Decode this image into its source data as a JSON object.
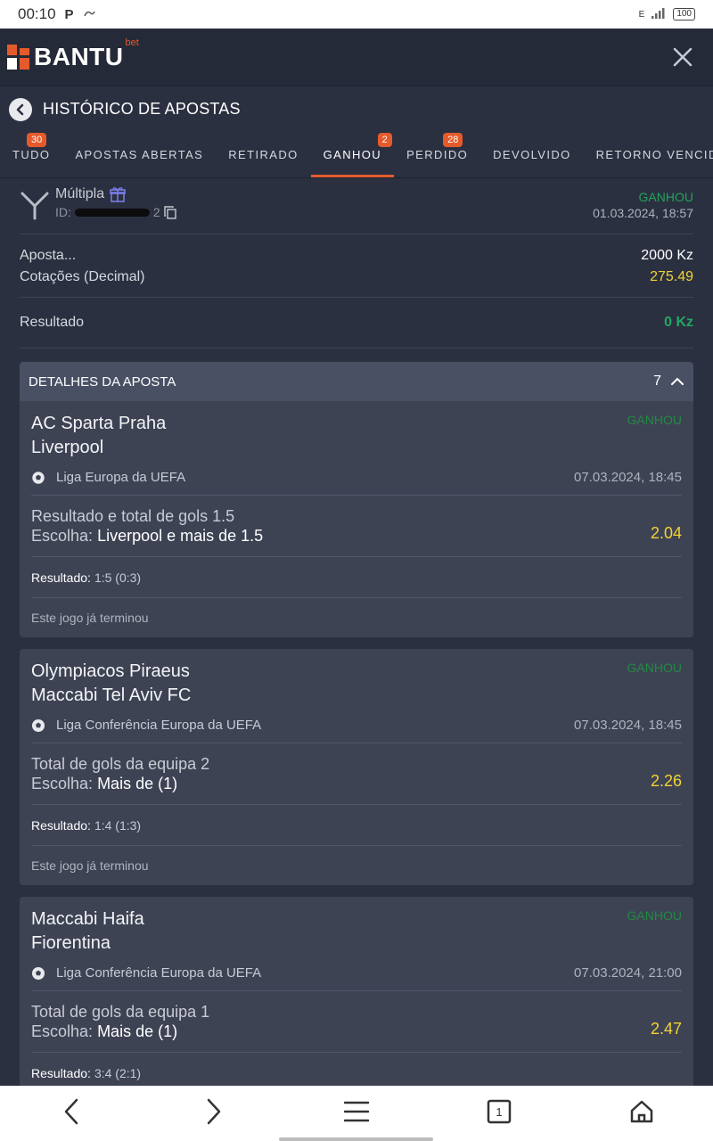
{
  "status_bar": {
    "time": "00:10",
    "notif": "P",
    "battery": "100"
  },
  "brand": {
    "name": "BANTU",
    "suffix": "bet"
  },
  "page": {
    "title": "HISTÓRICO DE APOSTAS"
  },
  "tabs": [
    {
      "label": "TUDO",
      "badge": "30"
    },
    {
      "label": "APOSTAS ABERTAS",
      "badge": ""
    },
    {
      "label": "RETIRADO",
      "badge": ""
    },
    {
      "label": "GANHOU",
      "badge": "2",
      "active": true
    },
    {
      "label": "PERDIDO",
      "badge": "28"
    },
    {
      "label": "DEVOLVIDO",
      "badge": ""
    },
    {
      "label": "RETORNO VENCIDO",
      "badge": ""
    }
  ],
  "bet": {
    "type": "Múltipla",
    "id_label": "ID:",
    "id_suffix": "2",
    "status": "GANHOU",
    "date": "01.03.2024, 18:57",
    "stake_label": "Aposta...",
    "stake_value": "2000 Kz",
    "odds_label": "Cotações (Decimal)",
    "odds_value": "275.49",
    "result_label": "Resultado",
    "result_value": "0 Kz"
  },
  "details": {
    "title": "DETALHES DA APOSTA",
    "count": "7"
  },
  "matches": [
    {
      "team1": "AC Sparta Praha",
      "team2": "Liverpool",
      "status": "GANHOU",
      "league": "Liga Europa da UEFA",
      "date": "07.03.2024, 18:45",
      "market": "Resultado e total de gols 1.5",
      "choice_label": "Escolha:",
      "choice": "Liverpool e mais de 1.5",
      "odd": "2.04",
      "score_label": "Resultado:",
      "score": "1:5 (0:3)",
      "ended": "Este jogo já terminou"
    },
    {
      "team1": "Olympiacos Piraeus",
      "team2": "Maccabi Tel Aviv FC",
      "status": "GANHOU",
      "league": "Liga Conferência Europa da UEFA",
      "date": "07.03.2024, 18:45",
      "market": "Total de gols da equipa 2",
      "choice_label": "Escolha:",
      "choice": "Mais de (1)",
      "odd": "2.26",
      "score_label": "Resultado:",
      "score": "1:4 (1:3)",
      "ended": "Este jogo já terminou"
    },
    {
      "team1": "Maccabi Haifa",
      "team2": "Fiorentina",
      "status": "GANHOU",
      "league": "Liga Conferência Europa da UEFA",
      "date": "07.03.2024, 21:00",
      "market": "Total de gols da equipa 1",
      "choice_label": "Escolha:",
      "choice": "Mais de (1)",
      "odd": "2.47",
      "score_label": "Resultado:",
      "score": "3:4 (2:1)",
      "ended": ""
    }
  ],
  "colors": {
    "accent": "#e55a2b",
    "win": "#1fa764",
    "odds": "#f1d433",
    "bg": "#2b3040"
  }
}
